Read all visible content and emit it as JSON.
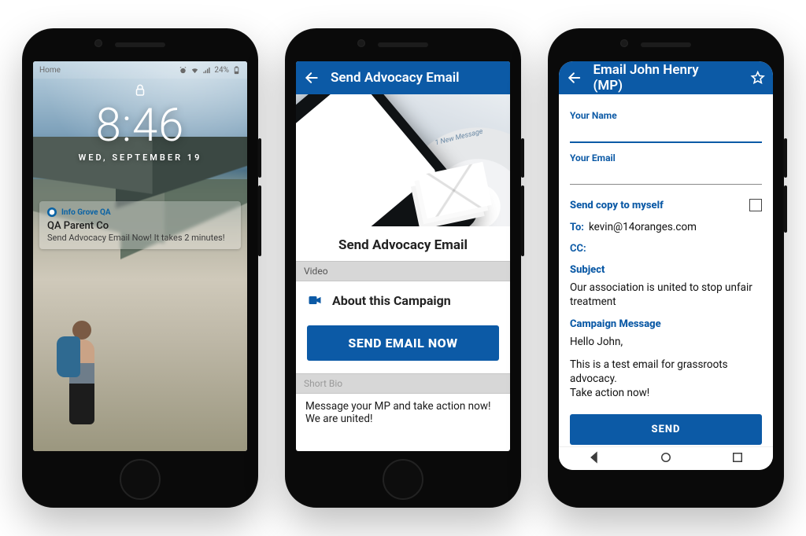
{
  "colors": {
    "brand": "#0c5aa6"
  },
  "phone1": {
    "status": {
      "left": "Home",
      "battery_text": "24%",
      "icons": [
        "alarm",
        "wifi",
        "signal",
        "battery"
      ]
    },
    "lock": {
      "time": "8:46",
      "date": "WED, SEPTEMBER 19"
    },
    "notification": {
      "app_name": "Info Grove QA",
      "title": "QA Parent Co",
      "body": "Send Advocacy Email Now! It takes 2 minutes!"
    }
  },
  "phone2": {
    "appbar_title": "Send Advocacy Email",
    "hero_tag": "1 New Message",
    "page_title": "Send Advocacy Email",
    "sections": {
      "video_header": "Video",
      "video_row": "About this Campaign",
      "bio_header": "Short Bio",
      "bio_text": "Message your MP and take action now! We are united!"
    },
    "cta": "SEND EMAIL NOW"
  },
  "phone3": {
    "appbar_title": "Email John Henry (MP)",
    "labels": {
      "name": "Your Name",
      "email": "Your Email",
      "send_copy": "Send copy to myself",
      "to": "To:",
      "cc": "CC:",
      "subject": "Subject",
      "campaign_msg": "Campaign Message"
    },
    "values": {
      "name": "",
      "email": "",
      "to": "kevin@14oranges.com",
      "cc": "",
      "subject": "Our association is united to stop unfair treatment",
      "msg_line1": "Hello John,",
      "msg_line2": "This is a test email for grassroots advocacy.",
      "msg_line3": "Take action now!"
    },
    "send": "SEND"
  }
}
